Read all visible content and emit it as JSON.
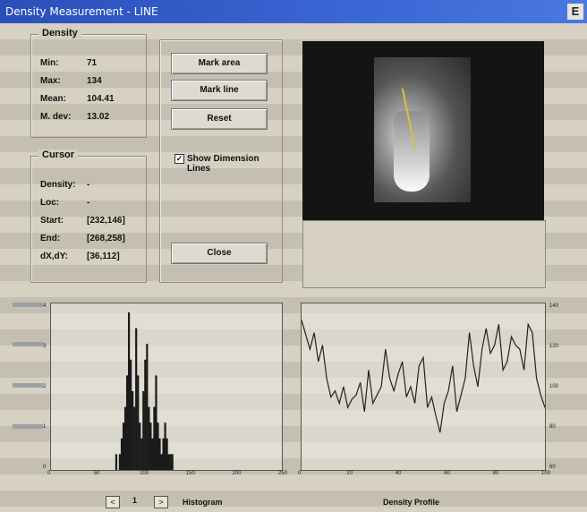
{
  "window": {
    "title": "Density Measurement - LINE",
    "close_glyph": "E"
  },
  "density": {
    "legend": "Density",
    "rows": [
      {
        "label": "Min:",
        "value": "71"
      },
      {
        "label": "Max:",
        "value": "134"
      },
      {
        "label": "Mean:",
        "value": "104.41"
      },
      {
        "label": "M. dev:",
        "value": "13.02"
      }
    ]
  },
  "cursor": {
    "legend": "Cursor",
    "rows": [
      {
        "label": "Density:",
        "value": "-"
      },
      {
        "label": "Loc:",
        "value": "-"
      },
      {
        "label": "Start:",
        "value": "[232,146]"
      },
      {
        "label": "End:",
        "value": "[268,258]"
      },
      {
        "label": "dX,dY:",
        "value": "[36,112]"
      }
    ]
  },
  "buttons": {
    "mark_area": "Mark area",
    "mark_line": "Mark line",
    "reset": "Reset",
    "close": "Close"
  },
  "show_dimension": {
    "label_line1": "Show Dimension",
    "label_line2": "Lines",
    "checked": true
  },
  "histogram": {
    "page": "1",
    "prev": "<",
    "next": ">",
    "label": "Histogram"
  },
  "profile": {
    "label": "Density Profile"
  },
  "chart_data": [
    {
      "type": "bar",
      "title": "Histogram",
      "xlim": [
        0,
        255
      ],
      "x_ticks": [
        "0",
        "50",
        "100",
        "150",
        "200",
        "250"
      ],
      "y_ticks": [
        "0",
        "1",
        "2",
        "3",
        "4"
      ],
      "x": [
        71,
        73,
        75,
        77,
        79,
        81,
        83,
        85,
        87,
        89,
        91,
        93,
        95,
        97,
        99,
        101,
        103,
        105,
        107,
        109,
        111,
        113,
        115,
        117,
        119,
        121,
        123,
        125,
        127,
        129,
        131,
        133
      ],
      "values": [
        1,
        0,
        1,
        2,
        3,
        4,
        6,
        10,
        7,
        5,
        4,
        9,
        6,
        3,
        2,
        5,
        7,
        8,
        4,
        3,
        2,
        4,
        6,
        3,
        2,
        1,
        2,
        3,
        2,
        1,
        1,
        1
      ]
    },
    {
      "type": "line",
      "title": "Density Profile",
      "xlim": [
        0,
        116
      ],
      "ylim": [
        60,
        140
      ],
      "x_ticks": [
        "0",
        "20",
        "40",
        "60",
        "80",
        "100"
      ],
      "y_ticks": [
        "60",
        "80",
        "100",
        "120",
        "140"
      ],
      "x": [
        0,
        2,
        4,
        6,
        8,
        10,
        12,
        14,
        16,
        18,
        20,
        22,
        24,
        26,
        28,
        30,
        32,
        34,
        36,
        38,
        40,
        42,
        44,
        46,
        48,
        50,
        52,
        54,
        56,
        58,
        60,
        62,
        64,
        66,
        68,
        70,
        72,
        74,
        76,
        78,
        80,
        82,
        84,
        86,
        88,
        90,
        92,
        94,
        96,
        98,
        100,
        102,
        104,
        106,
        108,
        110,
        112,
        114,
        116
      ],
      "values": [
        132,
        125,
        118,
        126,
        112,
        120,
        104,
        95,
        98,
        92,
        100,
        90,
        94,
        96,
        102,
        88,
        108,
        92,
        96,
        100,
        118,
        104,
        98,
        106,
        112,
        95,
        100,
        92,
        110,
        114,
        90,
        95,
        86,
        78,
        92,
        98,
        110,
        88,
        96,
        104,
        126,
        110,
        100,
        118,
        128,
        116,
        120,
        130,
        108,
        112,
        124,
        120,
        118,
        108,
        130,
        126,
        104,
        96,
        90
      ]
    }
  ]
}
